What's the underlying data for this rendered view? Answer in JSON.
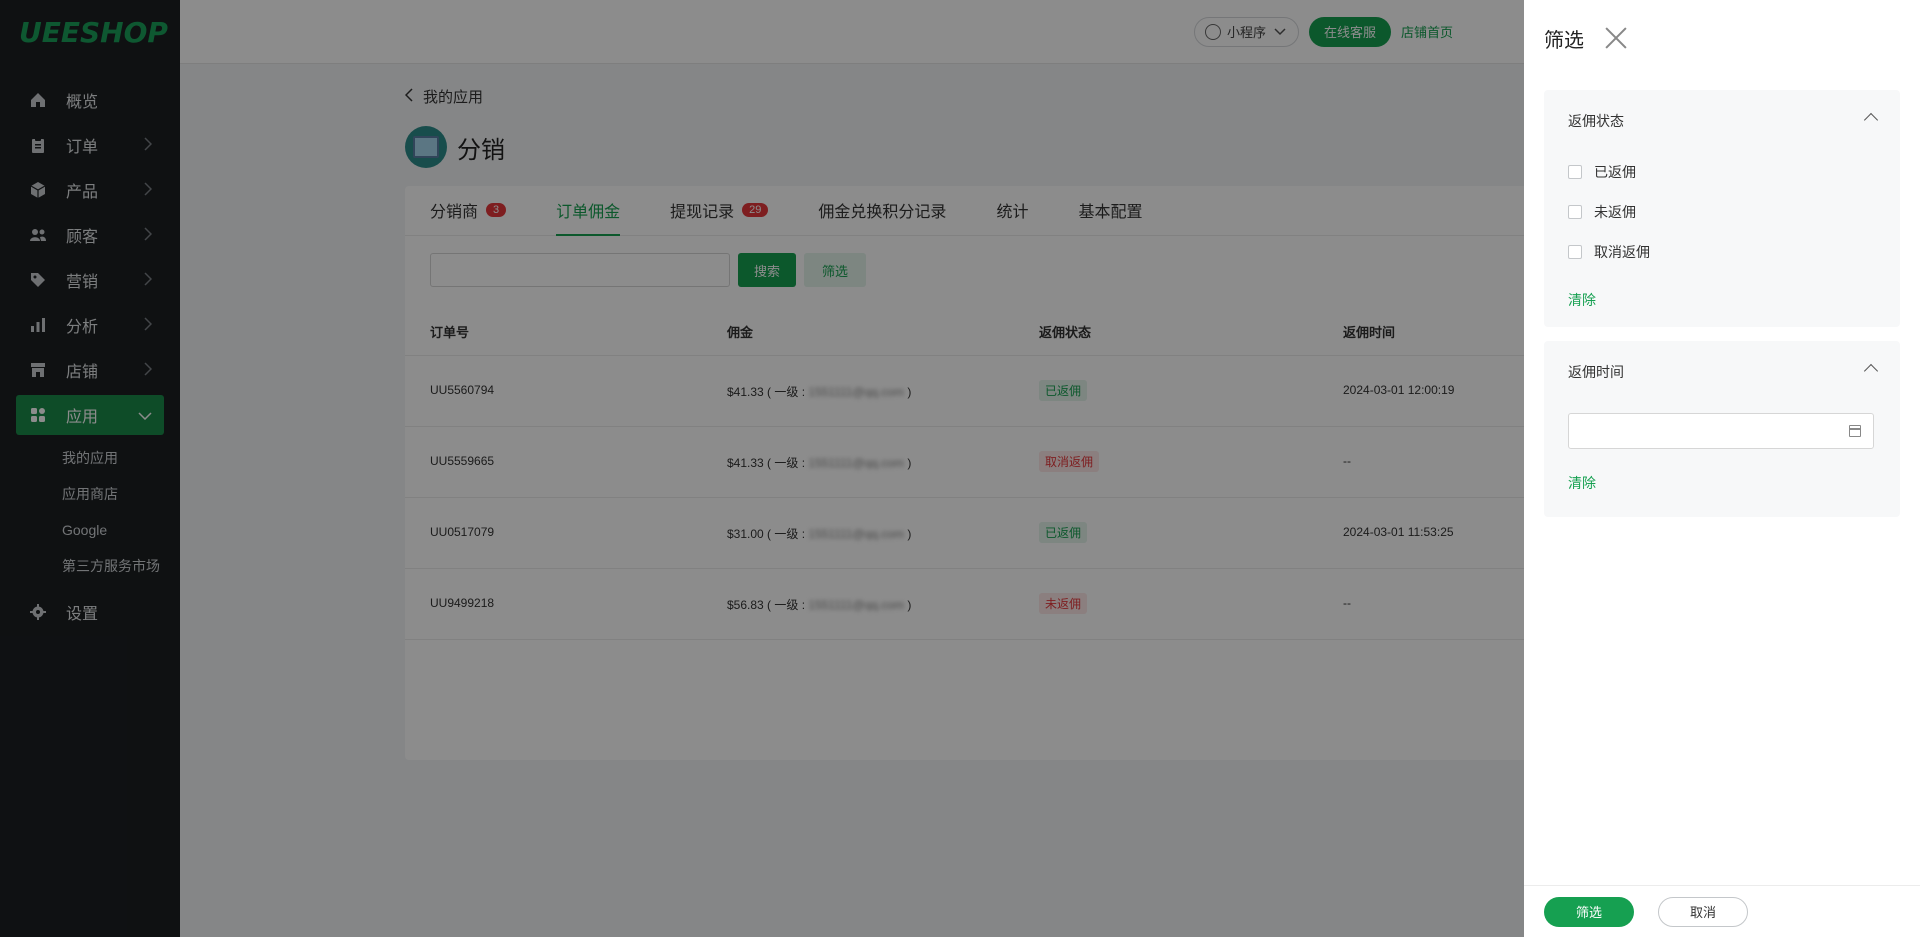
{
  "brand": {
    "logo_text": "UEESHOP"
  },
  "sidebar": {
    "items": [
      {
        "label": "概览",
        "icon": "home-icon"
      },
      {
        "label": "订单",
        "icon": "clipboard-icon"
      },
      {
        "label": "产品",
        "icon": "box-icon"
      },
      {
        "label": "顾客",
        "icon": "users-icon"
      },
      {
        "label": "营销",
        "icon": "tag-icon"
      },
      {
        "label": "分析",
        "icon": "bar-chart-icon"
      },
      {
        "label": "店铺",
        "icon": "store-icon"
      },
      {
        "label": "应用",
        "icon": "apps-icon"
      }
    ],
    "subitems": [
      "我的应用",
      "应用商店",
      "Google",
      "第三方服务市场"
    ],
    "settings_label": "设置"
  },
  "topbar": {
    "miniapp_label": "小程序",
    "online_service_label": "在线客服",
    "store_home_label": "店铺首页"
  },
  "breadcrumb": {
    "back_label": "我的应用"
  },
  "page": {
    "title": "分销"
  },
  "tabs": [
    {
      "label": "分销商",
      "badge": "3"
    },
    {
      "label": "订单佣金",
      "badge": ""
    },
    {
      "label": "提现记录",
      "badge": "29"
    },
    {
      "label": "佣金兑换积分记录",
      "badge": ""
    },
    {
      "label": "统计",
      "badge": ""
    },
    {
      "label": "基本配置",
      "badge": ""
    }
  ],
  "toolbar": {
    "search_value": "",
    "search_label": "搜索",
    "filter_label": "筛选"
  },
  "table": {
    "headers": [
      "订单号",
      "佣金",
      "返佣状态",
      "返佣时间"
    ],
    "rows": [
      {
        "order": "UU5560794",
        "commission": "$41.33 ( 一级 :",
        "email": "1551111@qq.com",
        "close": ")",
        "status": "已返佣",
        "status_type": "green",
        "time": "2024-03-01 12:00:19"
      },
      {
        "order": "UU5559665",
        "commission": "$41.33 ( 一级 :",
        "email": "1551111@qq.com",
        "close": ")",
        "status": "取消返佣",
        "status_type": "red",
        "time": "--"
      },
      {
        "order": "UU0517079",
        "commission": "$31.00 ( 一级 :",
        "email": "1551111@qq.com",
        "close": ")",
        "status": "已返佣",
        "status_type": "green",
        "time": "2024-03-01 11:53:25"
      },
      {
        "order": "UU9499218",
        "commission": "$56.83 ( 一级 :",
        "email": "1551111@qq.com",
        "close": ")",
        "status": "未返佣",
        "status_type": "red",
        "time": "--"
      }
    ]
  },
  "drawer": {
    "title": "筛选",
    "section_status": {
      "title": "返佣状态",
      "options": [
        "已返佣",
        "未返佣",
        "取消返佣"
      ],
      "clear_label": "清除"
    },
    "section_time": {
      "title": "返佣时间",
      "date_value": "",
      "clear_label": "清除"
    },
    "confirm_label": "筛选",
    "cancel_label": "取消"
  },
  "colors": {
    "accent": "#16a051",
    "sidebar_bg": "#1c1f22",
    "danger": "#e5383b"
  }
}
